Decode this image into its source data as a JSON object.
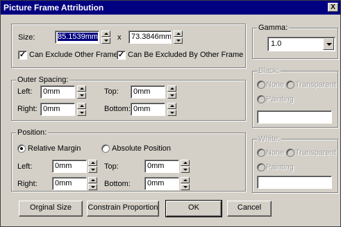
{
  "window": {
    "title": "Picture Frame Attribution",
    "close_glyph": "X"
  },
  "size": {
    "label": "Size:",
    "width_value": "85.1539mm",
    "separator": "x",
    "height_value": "73.3846mm",
    "can_exclude_other_label": "Can Exclude Other Frame",
    "can_be_excluded_label": "Can Be Excluded By Other Frame",
    "check_glyph": "✓"
  },
  "outer_spacing": {
    "label": "Outer Spacing:",
    "left_label": "Left:",
    "left_value": "0mm",
    "top_label": "Top:",
    "top_value": "0mm",
    "right_label": "Right:",
    "right_value": "0mm",
    "bottom_label": "Bottom:",
    "bottom_value": "0mm"
  },
  "position": {
    "label": "Position:",
    "relative_label": "Relative Margin",
    "absolute_label": "Absolute Position",
    "left_label": "Left:",
    "left_value": "0mm",
    "top_label": "Top:",
    "top_value": "0mm",
    "right_label": "Right:",
    "right_value": "0mm",
    "bottom_label": "Bottom:",
    "bottom_value": "0mm"
  },
  "gamma": {
    "label": "Gamma:",
    "value": "1.0"
  },
  "black": {
    "label": "Black:",
    "none_label": "None",
    "transparent_label": "Transparent",
    "painting_label": "Painting"
  },
  "white": {
    "label": "White:",
    "none_label": "None",
    "transparent_label": "Transparent",
    "painting_label": "Painting"
  },
  "buttons": {
    "original_size": "Orginal Size",
    "constrain": "Constrain Proportion",
    "ok": "OK",
    "cancel": "Cancel"
  },
  "colors": {
    "titlebar": "#000080",
    "face": "#d4d0c8"
  }
}
